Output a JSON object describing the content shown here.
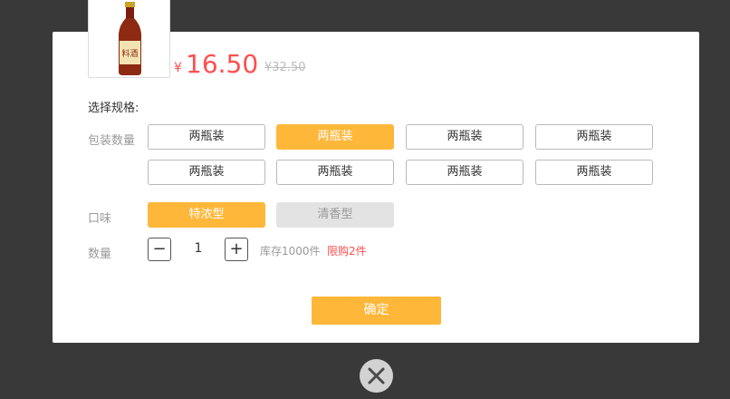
{
  "product": {
    "price_symbol": "¥",
    "price": "16.50",
    "original_price": "¥32.50",
    "bottle_label": "料酒"
  },
  "spec": {
    "section_title": "选择规格:",
    "package_label": "包装数量",
    "packages": [
      "两瓶装",
      "两瓶装",
      "两瓶装",
      "两瓶装",
      "两瓶装",
      "两瓶装",
      "两瓶装",
      "两瓶装"
    ],
    "package_selected_index": 1,
    "flavor_label": "口味",
    "flavors": [
      "特浓型",
      "清香型"
    ],
    "flavor_selected_index": 0,
    "flavor_disabled_index": 1
  },
  "quantity": {
    "label": "数量",
    "minus": "−",
    "value": "1",
    "plus": "+",
    "stock": "库存1000件",
    "limit": "限购2件"
  },
  "actions": {
    "confirm_label": "确定",
    "close_icon": "close-circle-icon"
  },
  "colors": {
    "accent": "#ffb73a",
    "price": "#ff4f4f",
    "overlay": "#393939"
  }
}
